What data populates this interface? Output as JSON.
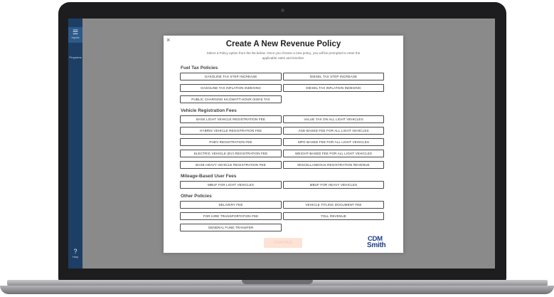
{
  "sidebar": {
    "items": [
      {
        "label": "Inputs",
        "icon": "sliders-icon"
      },
      {
        "label": "Programs",
        "icon": "folder-icon"
      },
      {
        "label": "Help",
        "icon": "help-icon"
      }
    ]
  },
  "modal": {
    "close": "×",
    "title": "Create A New Revenue Policy",
    "subtitle": "Select a Policy option from the list below. Once you choose a new policy, you will be prompted to enter the applicable rates and timeline.",
    "sections": {
      "fuel": {
        "title": "Fuel Tax Policies",
        "items": [
          "GASOLINE TAX STEP INCREASE",
          "DIESEL TAX STEP INCREASE",
          "GASOLINE TAX INFLATION INDEXING",
          "DIESEL TAX INFLATION INDEXING",
          "PUBLIC CHARGING KILOWATT-HOUR (KWH) TAX"
        ]
      },
      "vehicle": {
        "title": "Vehicle Registration Fees",
        "items": [
          "BASE LIGHT VEHICLE REGISTRATION FEE",
          "VALUE TAX ON ALL LIGHT VEHICLES",
          "HYBRID VEHICLE REGISTRATION FEE",
          "AGE-BASED FEE FOR ALL LIGHT VEHICLES",
          "PHEV REGISTRATION FEE",
          "MPG-BASED FEE FOR ALL LIGHT VEHICLES",
          "ELECTRIC VEHICLE (EV) REGISTRATION FEE",
          "WEIGHT-BASED FEE FOR ALL LIGHT VEHICLES",
          "BASE HEAVY VEHICLE REGISTRATION FEE",
          "MISCELLANEOUS REGISTRATION REVENUE"
        ]
      },
      "mileage": {
        "title": "Mileage-Based User Fees",
        "items": [
          "MBUF FOR LIGHT VEHICLES",
          "MBUF FOR HEAVY VEHICLES"
        ]
      },
      "other": {
        "title": "Other Policies",
        "items": [
          "DELIVERY FEE",
          "VEHICLE TITLING DOCUMENT FEE",
          "FOR HIRE TRANSPORTATION FEE",
          "TOLL REVENUE",
          "GENERAL FUND TRANSFER"
        ]
      }
    },
    "continue_label": "CONTINUE",
    "logo": {
      "line1": "CDM",
      "line2": "Smith"
    }
  },
  "colors": {
    "sidebar": "#1d3f66",
    "logo": "#1d3f8a",
    "continue_bg": "#fde3d5"
  }
}
